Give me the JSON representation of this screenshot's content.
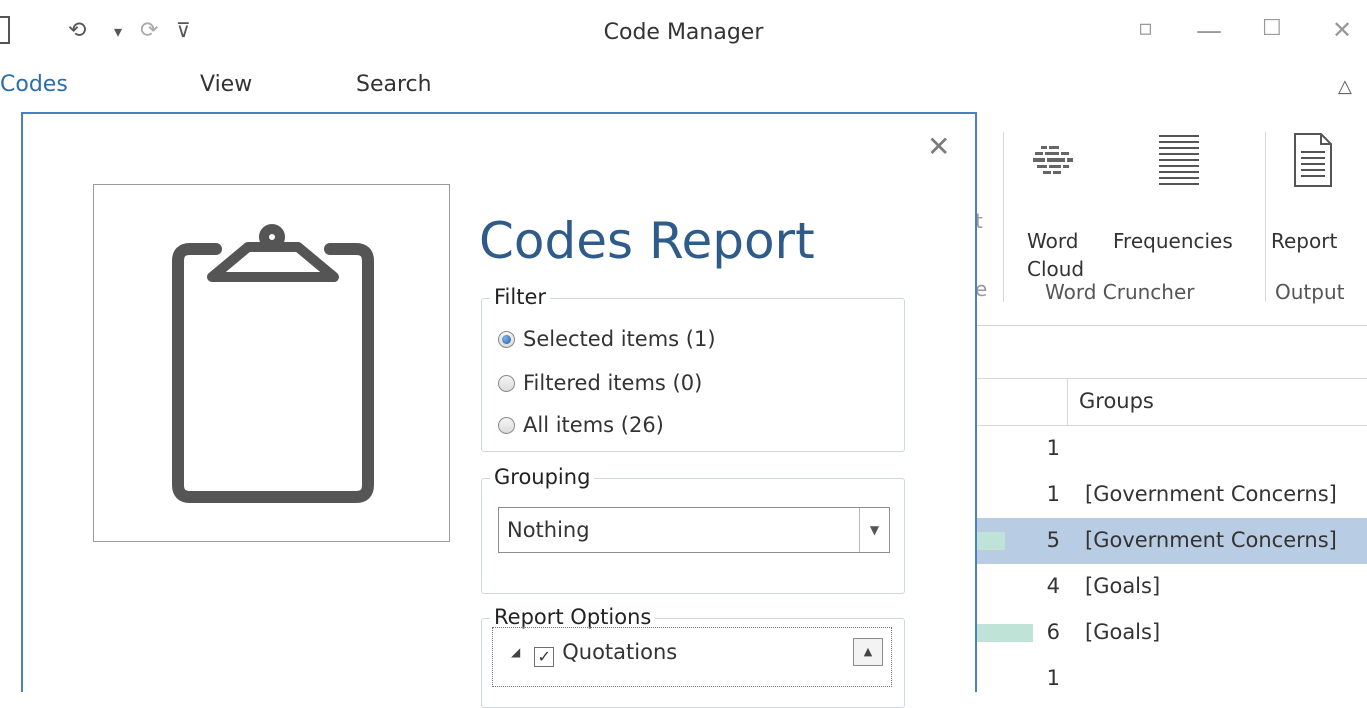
{
  "window": {
    "title": "Code Manager",
    "qat": {
      "undo_glyph": "⟲",
      "dropdown_glyph": "▾",
      "redo_glyph": "⟳",
      "customize_glyph": "⊽"
    },
    "controls": {
      "restore_glyph": "▫",
      "minimize_glyph": "—",
      "maximize_glyph": "☐",
      "close_glyph": "✕"
    }
  },
  "ribbon": {
    "tabs": [
      {
        "label": "Codes",
        "active": true
      },
      {
        "label": "View",
        "active": false
      },
      {
        "label": "Search",
        "active": false
      }
    ],
    "collapse_glyph": "△",
    "partial_label_t": "t",
    "partial_label_e": "e",
    "buttons": [
      {
        "label_line1": "Word",
        "label_line2": "Cloud"
      },
      {
        "label_line1": "Frequencies",
        "label_line2": ""
      },
      {
        "label_line1": "Report",
        "label_line2": ""
      }
    ],
    "groups": [
      "Word Cruncher",
      "Output"
    ]
  },
  "grid": {
    "header": {
      "groups_col": "Groups"
    },
    "rows": [
      {
        "count": "1",
        "groups": "",
        "bar": 0,
        "selected": false
      },
      {
        "count": "1",
        "groups": "[Government Concerns]",
        "bar": 0,
        "selected": false
      },
      {
        "count": "5",
        "groups": "[Government Concerns]",
        "bar": 0.5,
        "selected": true
      },
      {
        "count": "4",
        "groups": "[Goals]",
        "bar": 0,
        "selected": false
      },
      {
        "count": "6",
        "groups": "[Goals]",
        "bar": 1,
        "selected": false
      },
      {
        "count": "1",
        "groups": "",
        "bar": 0,
        "selected": false
      }
    ]
  },
  "dialog": {
    "close_glyph": "✕",
    "title": "Codes Report",
    "filter": {
      "legend": "Filter",
      "options": [
        {
          "label": "Selected items (1)",
          "checked": true
        },
        {
          "label": "Filtered items (0)",
          "checked": false
        },
        {
          "label": "All items (26)",
          "checked": false
        }
      ]
    },
    "grouping": {
      "legend": "Grouping",
      "value": "Nothing",
      "dropdown_glyph": "▼"
    },
    "report_options": {
      "legend": "Report Options",
      "items": [
        {
          "label": "Quotations",
          "checked": true,
          "expand_glyph": "◢",
          "check_glyph": "✓"
        }
      ],
      "scroll_glyph": "▲"
    }
  },
  "colors": {
    "accent": "#2b6cb0",
    "dialog_border": "#4a7fc1",
    "title": "#2f5b8a",
    "selection": "#b8cde3",
    "bar": "#bfe3d6"
  }
}
